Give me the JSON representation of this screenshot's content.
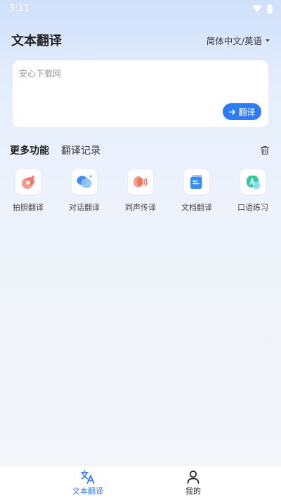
{
  "status_bar": {
    "time": "3:11"
  },
  "header": {
    "title": "文本翻译",
    "language_pair": "简体中文/英语"
  },
  "input": {
    "placeholder": "安心下载网",
    "translate_label": "翻译"
  },
  "tabs": [
    {
      "label": "更多功能",
      "active": true
    },
    {
      "label": "翻译记录",
      "active": false
    }
  ],
  "features": [
    {
      "label": "拍照翻译",
      "icon": "camera-translate-icon"
    },
    {
      "label": "对话翻译",
      "icon": "chat-bubbles-icon"
    },
    {
      "label": "同声传译",
      "icon": "sound-wave-icon"
    },
    {
      "label": "文档翻译",
      "icon": "document-icon"
    },
    {
      "label": "口语练习",
      "icon": "speaking-practice-icon"
    }
  ],
  "bottom_nav": [
    {
      "label": "文本翻译",
      "icon": "translate-icon",
      "active": true
    },
    {
      "label": "我的",
      "icon": "user-icon",
      "active": false
    }
  ],
  "colors": {
    "accent": "#2f7bf5"
  }
}
